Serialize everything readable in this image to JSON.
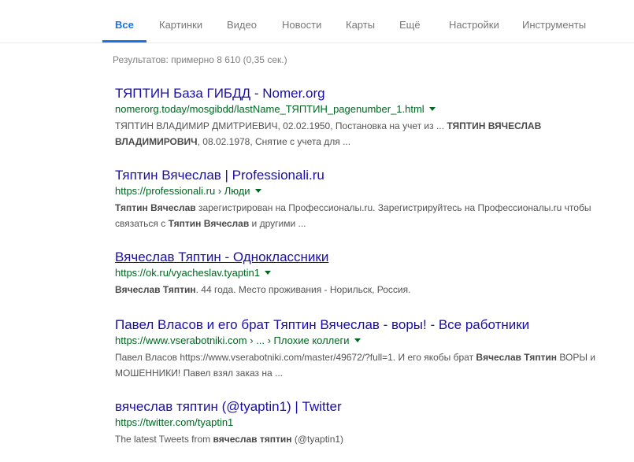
{
  "tabs": [
    {
      "label": "Все",
      "active": true
    },
    {
      "label": "Картинки"
    },
    {
      "label": "Видео"
    },
    {
      "label": "Новости"
    },
    {
      "label": "Карты"
    },
    {
      "label": "Ещё"
    },
    {
      "label": "Настройки"
    },
    {
      "label": "Инструменты"
    }
  ],
  "stats": "Результатов: примерно 8 610 (0,35 сек.)",
  "results": [
    {
      "title": "ТЯПТИН База ГИБДД - Nomer.org",
      "url": "nomerorg.today/mosgibdd/lastName_ТЯПТИН_pagenumber_1.html",
      "snippet": [
        {
          "t": "ТЯПТИН ВЛАДИМИР ДМИТРИЕВИЧ, 02.02.1950, Постановка на учет из ... "
        },
        {
          "t": "ТЯПТИН ВЯЧЕСЛАВ ВЛАДИМИРОВИЧ",
          "b": true
        },
        {
          "t": ", 08.02.1978, Снятие с учета для ..."
        }
      ]
    },
    {
      "title": "Тяптин Вячеслав | Professionali.ru",
      "url": "https://professionali.ru › Люди",
      "snippet": [
        {
          "t": "Тяптин Вячеслав",
          "b": true
        },
        {
          "t": " зарегистрирован на Профессионалы.ru. Зарегистрируйтесь на Профессионалы.ru чтобы связаться с "
        },
        {
          "t": "Тяптин Вячеслав",
          "b": true
        },
        {
          "t": " и другими ..."
        }
      ]
    },
    {
      "title": "Вячеслав Тяптин - Одноклассники",
      "url": "https://ok.ru/vyacheslav.tyaptin1",
      "snippet": [
        {
          "t": "Вячеслав Тяптин",
          "b": true
        },
        {
          "t": ". 44 года. Место проживания - Норильск, Россия."
        }
      ]
    },
    {
      "title": "Павел Власов и его брат Тяптин Вячеслав - воры! - Все работники",
      "url": "https://www.vserabotniki.com › ... › Плохие коллеги",
      "snippet": [
        {
          "t": "Павел Власов https://www.vserabotniki.com/master/49672/?full=1. И его якобы брат "
        },
        {
          "t": "Вячеслав Тяптин",
          "b": true
        },
        {
          "t": " ВОРЫ и МОШЕННИКИ! Павел взял заказ на ..."
        }
      ]
    },
    {
      "title": "вячеслав тяптин (@tyaptin1) | Twitter",
      "url": "https://twitter.com/tyaptin1",
      "snippet": [
        {
          "t": "The latest Tweets from "
        },
        {
          "t": "вячеслав тяптин",
          "b": true
        },
        {
          "t": " (@tyaptin1)"
        }
      ]
    }
  ]
}
